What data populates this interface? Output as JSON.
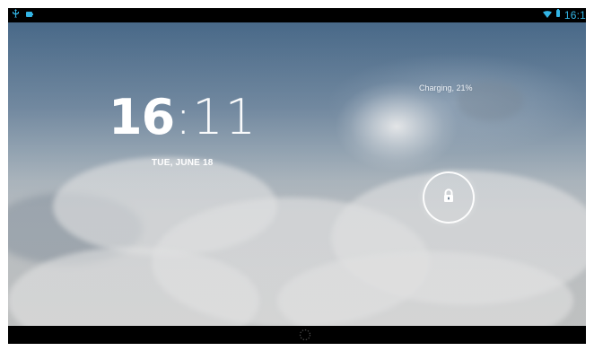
{
  "status_bar": {
    "time": "16:1",
    "left_icons": [
      "usb-icon",
      "battery-icon"
    ],
    "right_icons": [
      "wifi-icon",
      "signal-icon"
    ]
  },
  "lockscreen": {
    "clock_hour": "16",
    "clock_separator": ":",
    "clock_minutes": "11",
    "date": "TUE, JUNE 18",
    "charging_status": "Charging, 21%",
    "lock_icon": "lock-icon"
  },
  "navigation": {
    "home_icon": "home-icon"
  },
  "theme": {
    "status_accent": "#33b5e5",
    "text_color": "#ffffff"
  }
}
